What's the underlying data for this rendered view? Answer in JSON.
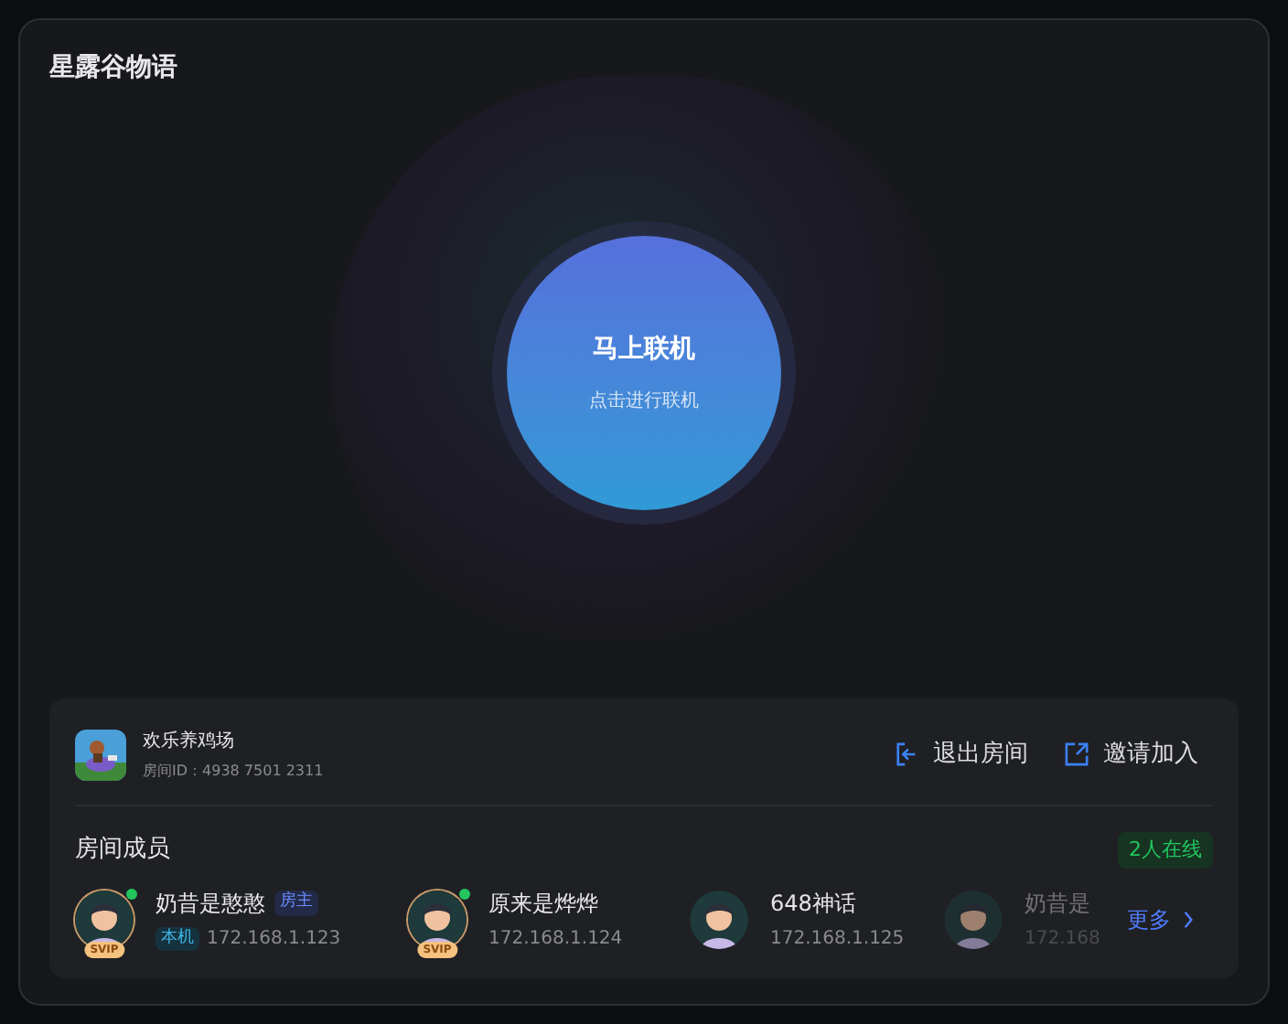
{
  "window": {
    "title": "星露谷物语"
  },
  "connect_button": {
    "label": "马上联机",
    "hint": "点击进行联机"
  },
  "room": {
    "name": "欢乐养鸡场",
    "room_id": "房间ID：4938 7501 2311",
    "actions": [
      {
        "kind": "exit",
        "label": "退出房间"
      },
      {
        "kind": "invite",
        "label": "邀请加入"
      }
    ]
  },
  "members": {
    "title": "房间成员",
    "online_count": "2人在线",
    "items": [
      {
        "name": "奶昔是憨憨",
        "ip": "172.168.1.123",
        "online": true,
        "svip": true,
        "svip_label": "SVIP",
        "host_badge": "房主",
        "local_badge": "本机",
        "dimmed": false
      },
      {
        "name": "原来是烨烨",
        "ip": "172.168.1.124",
        "online": true,
        "svip": true,
        "svip_label": "SVIP",
        "dimmed": false
      },
      {
        "name": "648神话",
        "ip": "172.168.1.125",
        "online": false,
        "svip": false,
        "dimmed": false
      },
      {
        "name": "奶昔是",
        "ip": "172.168",
        "online": false,
        "svip": false,
        "dimmed": true
      }
    ],
    "more": "更多"
  }
}
